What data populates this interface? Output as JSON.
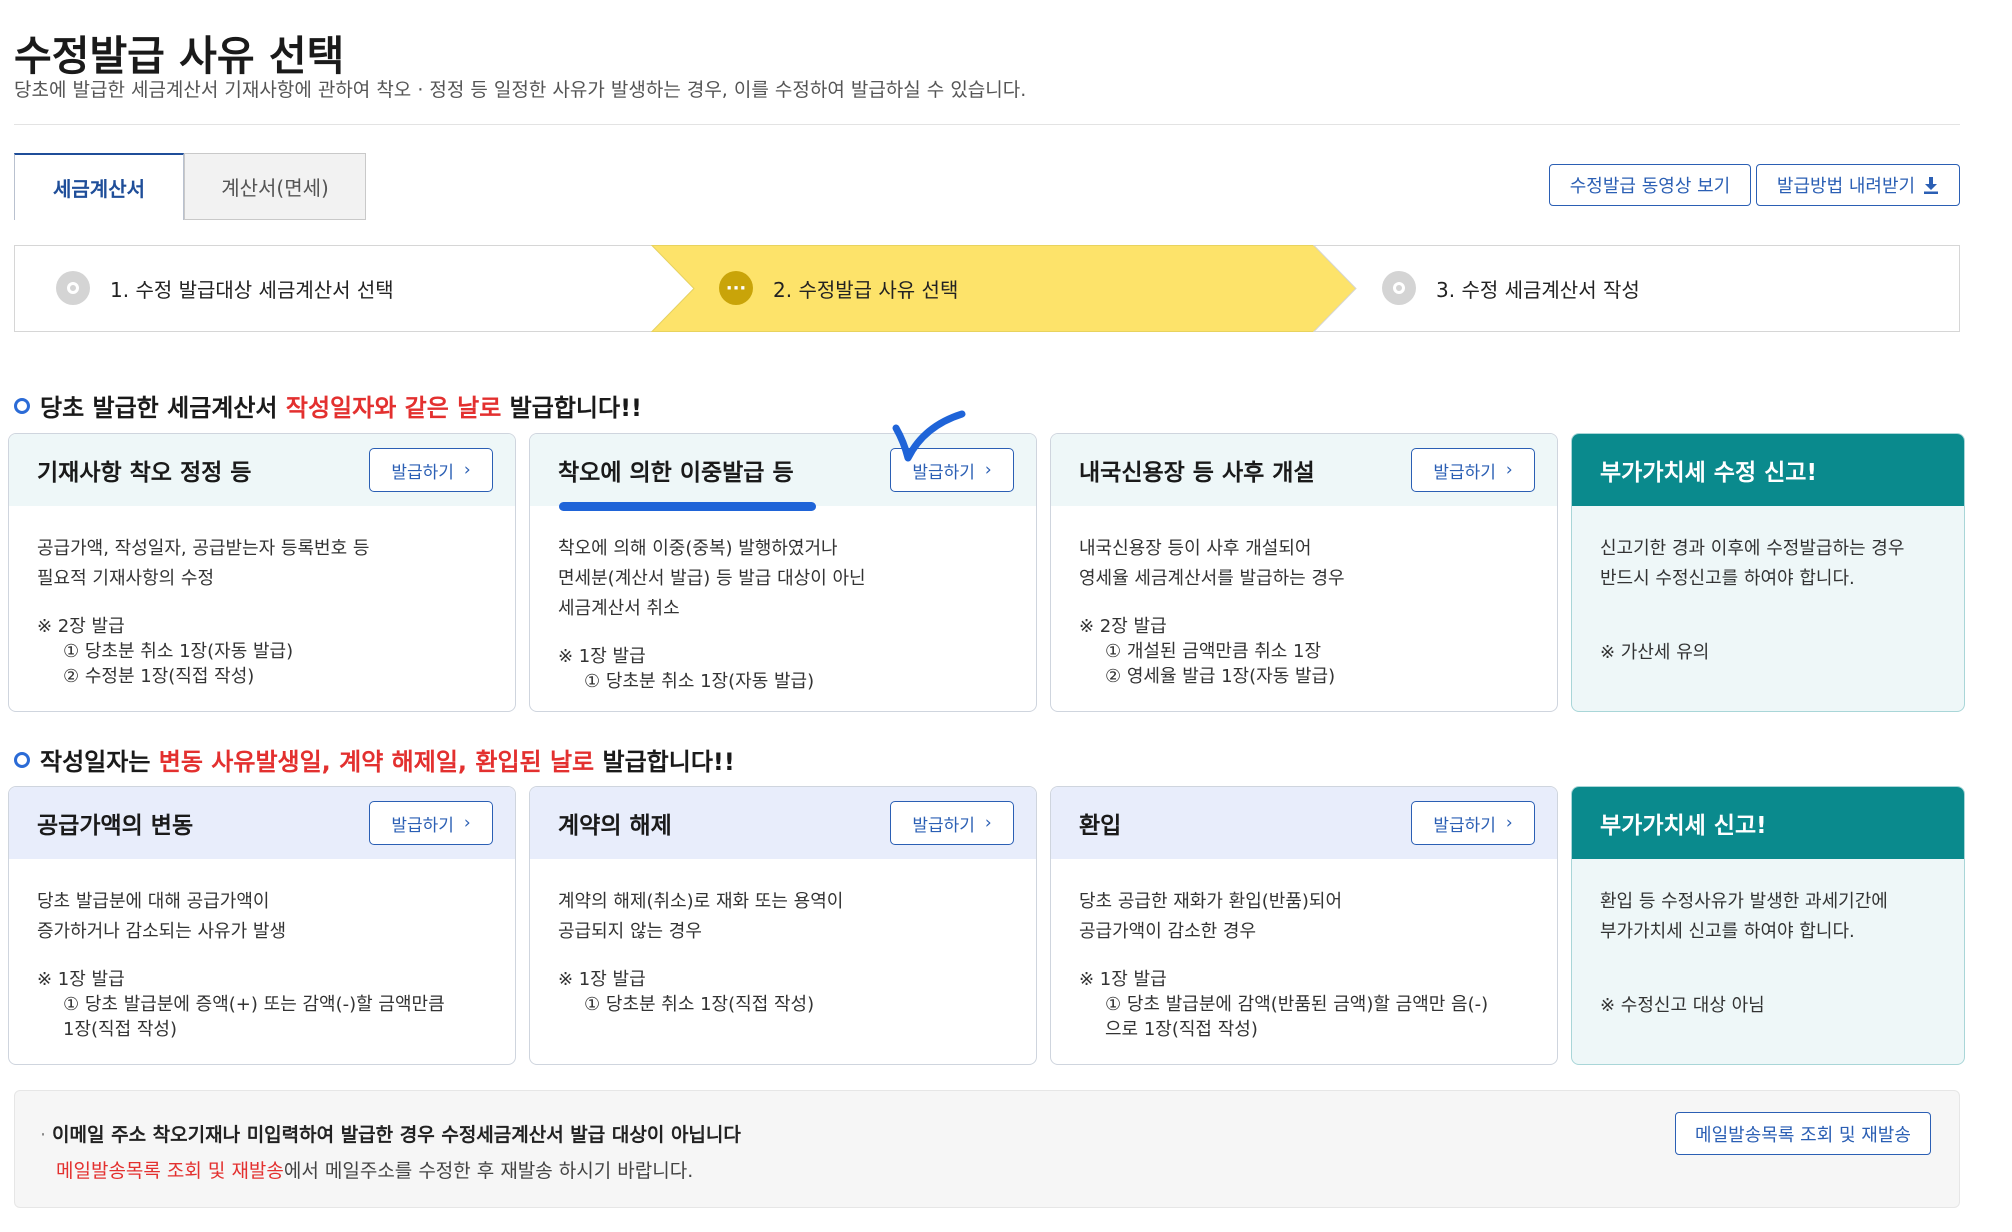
{
  "page": {
    "title": "수정발급 사유 선택",
    "description": "당초에 발급한 세금계산서 기재사항에 관하여 착오 · 정정 등 일정한 사유가 발생하는 경우, 이를 수정하여 발급하실 수 있습니다."
  },
  "tabs": [
    {
      "label": "세금계산서",
      "active": true
    },
    {
      "label": "계산서(면세)",
      "active": false
    }
  ],
  "top_buttons": {
    "video": "수정발급 동영상 보기",
    "download": "발급방법 내려받기"
  },
  "steps": [
    {
      "label": "1. 수정 발급대상 세금계산서 선택",
      "state": "done"
    },
    {
      "label": "2. 수정발급 사유 선택",
      "state": "current"
    },
    {
      "label": "3. 수정 세금계산서 작성",
      "state": "pending"
    }
  ],
  "section1": {
    "prefix": "당초 발급한 세금계산서 ",
    "highlight": "작성일자와 같은 날로",
    "suffix": " 발급합니다!!"
  },
  "section2": {
    "prefix": "작성일자는 ",
    "highlight": "변동 사유발생일, 계약 해제일, 환입된 날로",
    "suffix": " 발급합니다!!"
  },
  "issue_button_label": "발급하기",
  "cards_row1": [
    {
      "title": "기재사항 착오 정정 등",
      "body": [
        "공급가액, 작성일자, 공급받는자 등록번호 등",
        "필요적 기재사항의 수정"
      ],
      "note_title": "※ 2장 발급",
      "notes": [
        "① 당초분 취소 1장(자동 발급)",
        "② 수정분 1장(직접 작성)"
      ]
    },
    {
      "title": "착오에 의한 이중발급 등",
      "body": [
        "착오에 의해 이중(중복) 발행하였거나",
        "면세분(계산서 발급) 등 발급 대상이 아닌",
        "세금계산서 취소"
      ],
      "note_title": "※ 1장 발급",
      "notes": [
        "① 당초분 취소 1장(자동 발급)"
      ]
    },
    {
      "title": "내국신용장 등 사후 개설",
      "body": [
        "내국신용장 등이 사후 개설되어",
        "영세율 세금계산서를 발급하는 경우"
      ],
      "note_title": "※ 2장 발급",
      "notes": [
        "① 개설된 금액만큼 취소 1장",
        "② 영세율 발급 1장(자동 발급)"
      ]
    },
    {
      "title": "부가가치세 수정 신고!",
      "body": [
        "신고기한 경과 이후에 수정발급하는 경우",
        "반드시 수정신고를 하여야 합니다."
      ],
      "warning": "※ 가산세 유의"
    }
  ],
  "cards_row2": [
    {
      "title": "공급가액의 변동",
      "body": [
        "당초 발급분에 대해 공급가액이",
        "증가하거나 감소되는 사유가 발생"
      ],
      "note_title": "※ 1장 발급",
      "notes": [
        "① 당초 발급분에 증액(+) 또는 감액(-)할 금액만큼",
        "1장(직접 작성)"
      ]
    },
    {
      "title": "계약의 해제",
      "body": [
        "계약의 해제(취소)로 재화 또는 용역이",
        "공급되지 않는 경우"
      ],
      "note_title": "※ 1장 발급",
      "notes": [
        "① 당초분 취소 1장(직접 작성)"
      ]
    },
    {
      "title": "환입",
      "body": [
        "당초 공급한 재화가 환입(반품)되어",
        "공급가액이 감소한 경우"
      ],
      "note_title": "※ 1장 발급",
      "notes": [
        "① 당초 발급분에 감액(반품된 금액)할 금액만 음(-)",
        "으로 1장(직접 작성)"
      ]
    },
    {
      "title": "부가가치세 신고!",
      "body": [
        "환입 등 수정사유가 발생한 과세기간에",
        "부가가치세 신고를 하여야 합니다."
      ],
      "warning": "※ 수정신고 대상 아님"
    }
  ],
  "notice": {
    "main": "이메일 주소 착오기재나 미입력하여 발급한 경우 수정세금계산서 발급 대상이 아닙니다",
    "link_text": "메일발송목록 조회 및 재발송",
    "sub_suffix": "에서 메일주소를 수정한 후 재발송 하시기 바랍니다.",
    "button": "메일발송목록 조회 및 재발송"
  },
  "colors": {
    "accent_blue": "#2b5fb4",
    "step_current_yellow": "#fde36a",
    "teal": "#0a8a8d",
    "highlight_red": "#e3302f"
  }
}
